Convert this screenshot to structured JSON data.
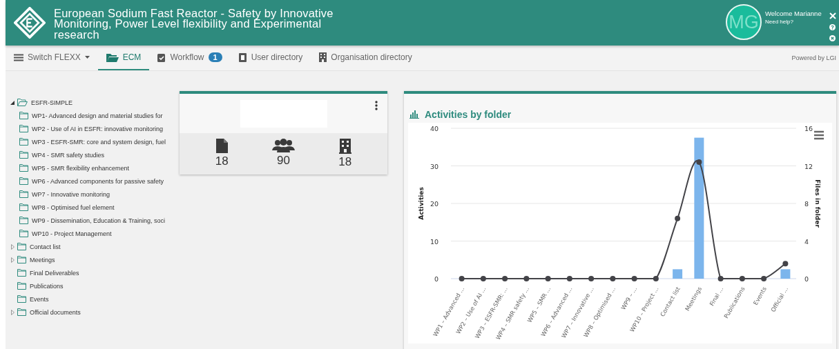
{
  "header": {
    "title": "European Sodium Fast Reactor - Safety by Innovative Monitoring, Power Level flexibility and Experimental research",
    "avatar_initials": "MG",
    "welcome": "Welcome Marianne",
    "help": "Need help?"
  },
  "nav": {
    "items": [
      {
        "label": "Switch FLEXX",
        "kind": "menu",
        "selected": false
      },
      {
        "label": "ECM",
        "kind": "folder",
        "selected": true
      },
      {
        "label": "Workflow",
        "kind": "workflow",
        "selected": false,
        "badge": "1"
      },
      {
        "label": "User directory",
        "kind": "users",
        "selected": false
      },
      {
        "label": "Organisation directory",
        "kind": "building",
        "selected": false
      }
    ],
    "powered_by": "Powered by LGI"
  },
  "tree": [
    {
      "label": "ESFR-SIMPLE",
      "expanded": true,
      "children": [
        {
          "label": "WP1- Advanced design and material studies for"
        },
        {
          "label": "WP2 - Use of AI in ESFR: innovative monitoring"
        },
        {
          "label": "WP3 - ESFR-SMR: core and system design, fuel"
        },
        {
          "label": "WP4 - SMR safety studies"
        },
        {
          "label": "WP5 - SMR flexibility enhancement"
        },
        {
          "label": "WP6 - Advanced components for passive safety"
        },
        {
          "label": "WP7 - Innovative monitoring"
        },
        {
          "label": "WP8 - Optimised fuel element"
        },
        {
          "label": "WP9 - Dissemination, Education & Training, soci"
        },
        {
          "label": "WP10 - Project Management"
        }
      ]
    },
    {
      "label": "Contact list",
      "expanded": false
    },
    {
      "label": "Meetings",
      "expanded": false
    },
    {
      "label": "Final Deliverables"
    },
    {
      "label": "Publications"
    },
    {
      "label": "Events"
    },
    {
      "label": "Official documents",
      "expanded": false
    }
  ],
  "stats_card": {
    "stats": [
      {
        "kind": "file",
        "value": "18"
      },
      {
        "kind": "users",
        "value": "90"
      },
      {
        "kind": "building",
        "value": "18"
      }
    ]
  },
  "chart_panel": {
    "title": "Activities by folder",
    "chart_data": {
      "type": "bar",
      "grid": true,
      "ylabel": "Activities",
      "y2label": "Files in folder",
      "categories": [
        "WP1 – Advanced ...",
        "WP2 – Use of AI ...",
        "WP3 – ESFR-SMR: ...",
        "WP4 – SMR safety ...",
        "WP5 – SMR ...",
        "WP6 – Advanced ...",
        "WP7 – Innovative ...",
        "WP8 – Optimised ...",
        "WP9 – ...",
        "WP10 – Project ...",
        "Contact list",
        "Meetings",
        "Final ...",
        "Publications",
        "Events",
        "Official ..."
      ],
      "series": [
        {
          "axis": "y2",
          "color": "#7cb5ec",
          "values": [
            0,
            0,
            0,
            0,
            0,
            0,
            0,
            0,
            0,
            0,
            1,
            15,
            0,
            0,
            0,
            1
          ]
        },
        {
          "type": "line",
          "marker": "circle",
          "color": "#434348",
          "values": [
            0,
            0,
            0,
            0,
            0,
            0,
            0,
            0,
            0,
            0,
            16,
            31,
            0,
            0,
            0,
            4
          ]
        }
      ],
      "ylim": [
        0,
        40
      ],
      "yticks": [
        0,
        10,
        20,
        30,
        40
      ],
      "y2lim": [
        0,
        16
      ],
      "y2ticks": [
        0,
        4,
        8,
        12,
        16
      ]
    }
  }
}
